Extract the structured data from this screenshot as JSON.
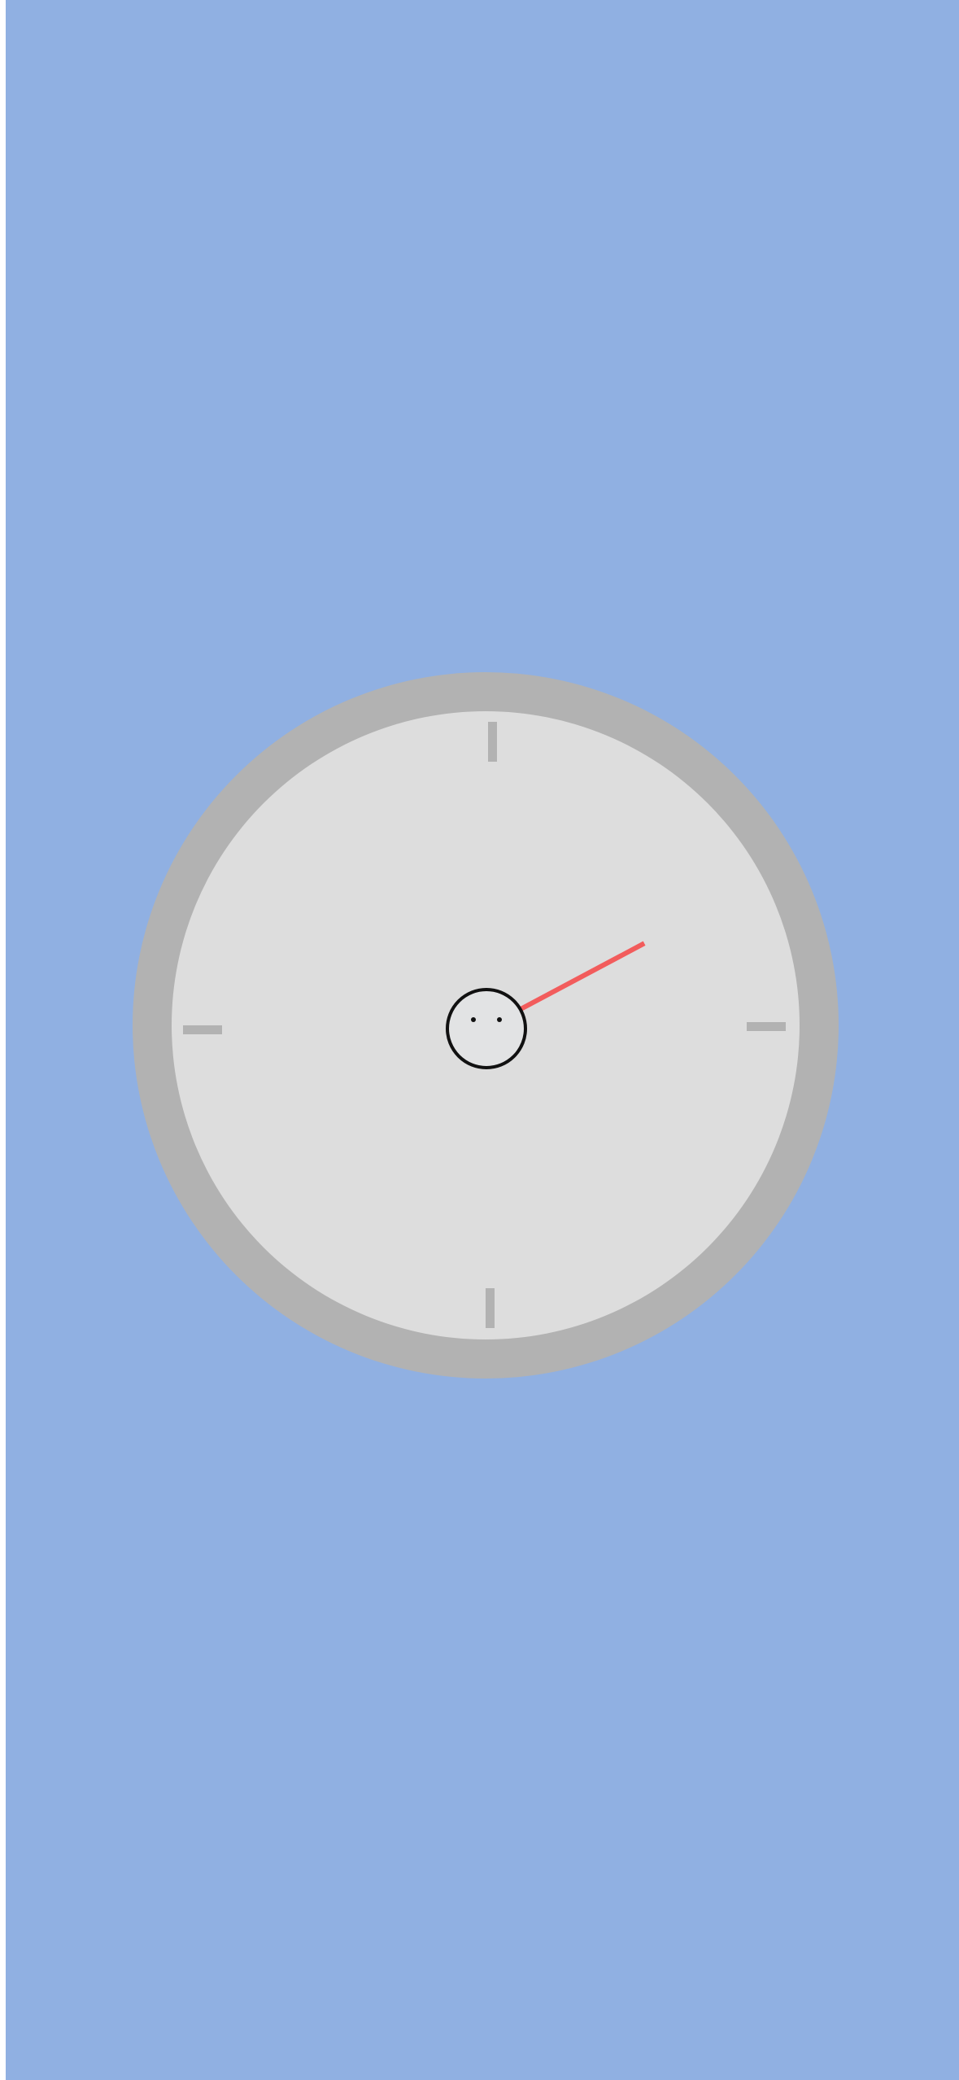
{
  "colors": {
    "background": "#90B0E2",
    "bezel": "#B2B2B2",
    "face": "#DDDDDD",
    "tick": "#B2B2B2",
    "needle": "#F25C5C",
    "hub_fill": "#E2E3E4",
    "hub_stroke": "#111111",
    "hub_dots": "#111111"
  },
  "dial": {
    "needle_angle_deg": 62,
    "tick_marks": [
      "top",
      "right",
      "bottom",
      "left"
    ],
    "hub_face": "two-dot-face"
  }
}
